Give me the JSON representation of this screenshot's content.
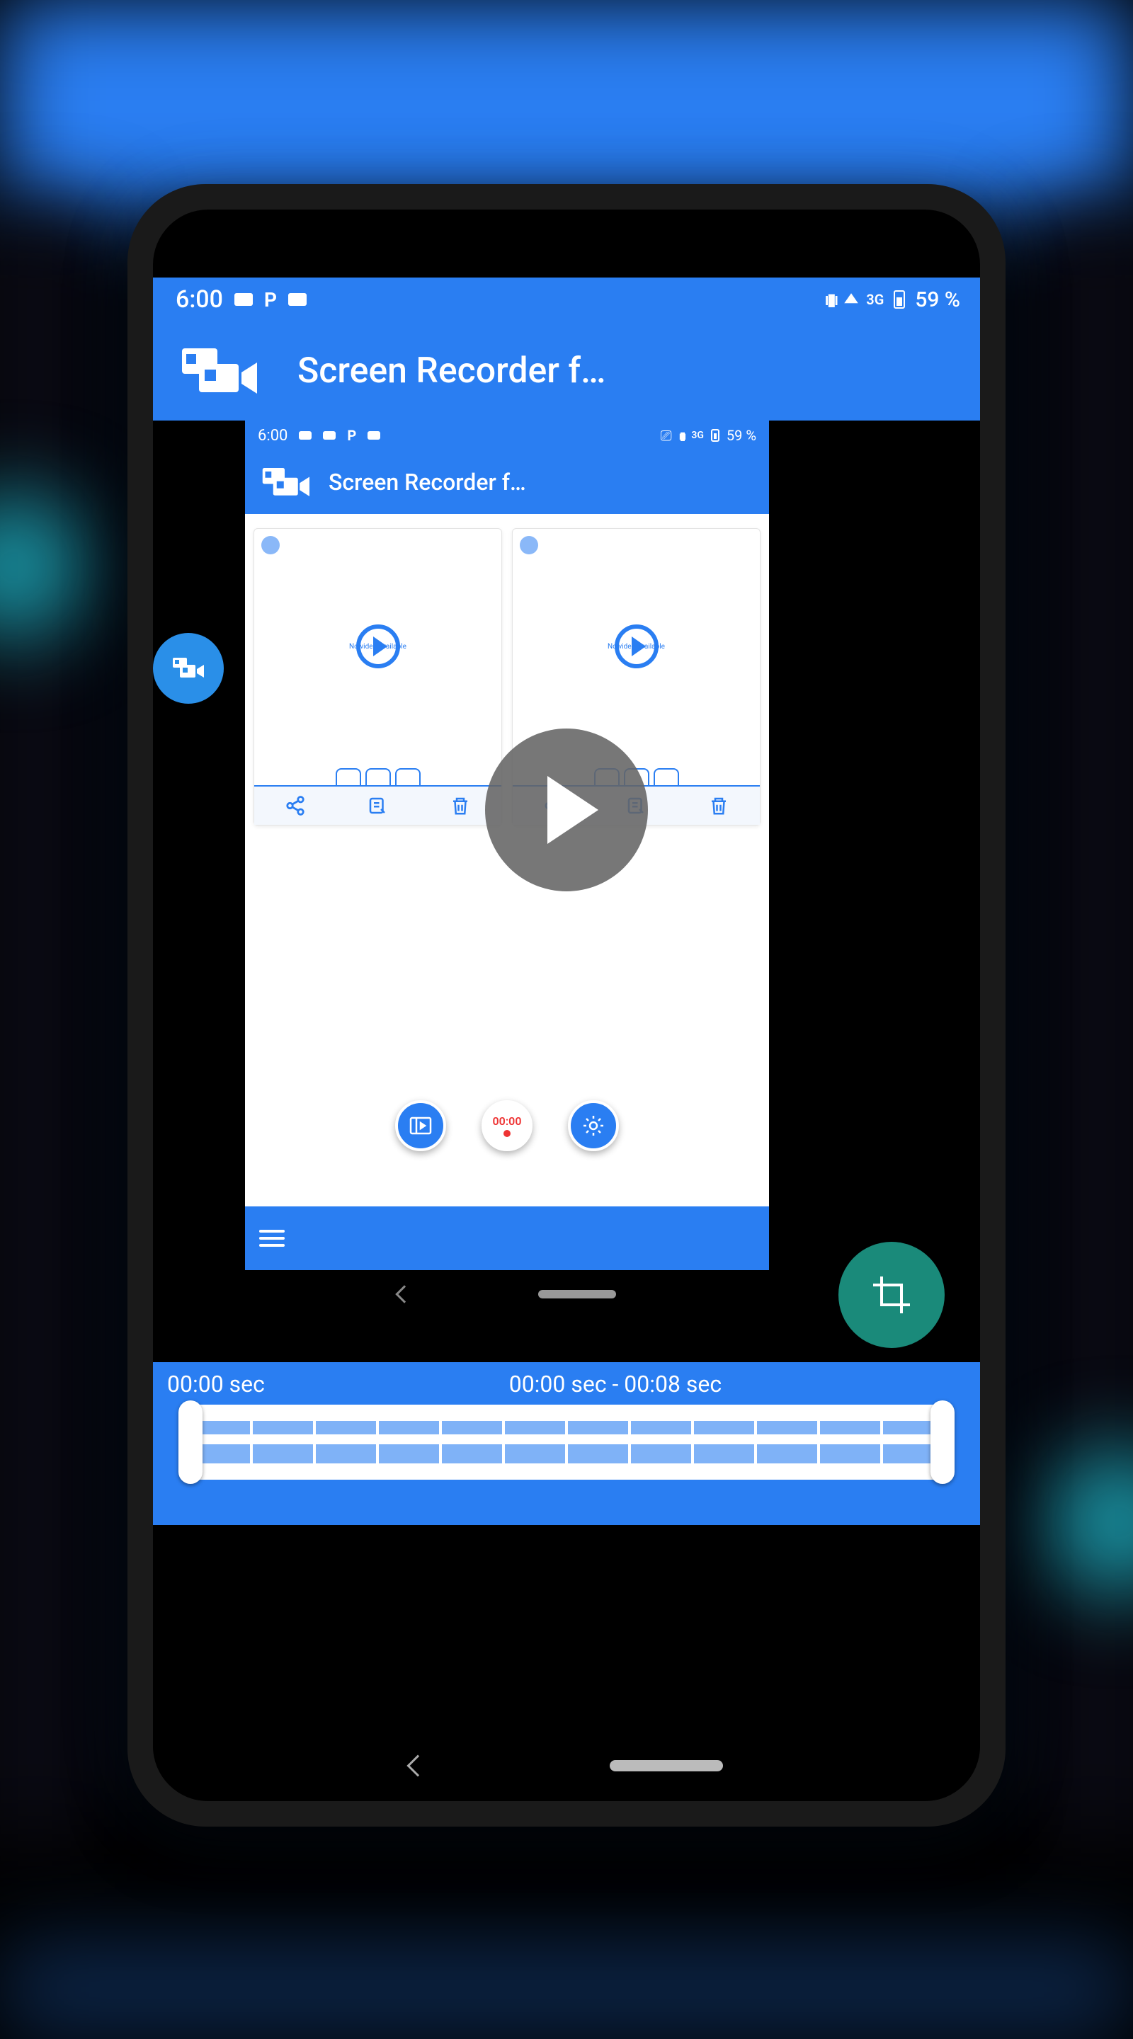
{
  "colors": {
    "primary": "#2a7ef2",
    "teal": "#1a8a7a"
  },
  "outer_status": {
    "time": "6:00",
    "battery": "59 %",
    "network": "3G"
  },
  "outer_appbar": {
    "title": "Screen Recorder f…"
  },
  "inner_status": {
    "time": "6:00",
    "battery": "59 %",
    "network": "3G"
  },
  "inner_appbar": {
    "title": "Screen Recorder f…"
  },
  "cards": [
    {
      "label": "No video available"
    },
    {
      "label": "No video available"
    }
  ],
  "record_button": {
    "time": "00:00"
  },
  "timeline": {
    "left_label": "00:00 sec",
    "center_label": "00:00 sec - 00:08 sec"
  }
}
